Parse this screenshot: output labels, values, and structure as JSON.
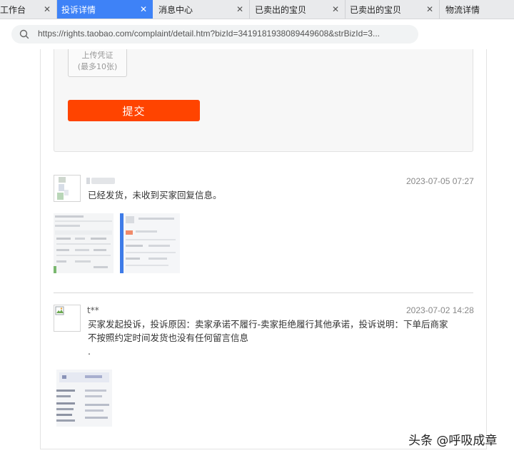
{
  "tabs": [
    {
      "label": "工作台",
      "active": false
    },
    {
      "label": "投诉详情",
      "active": true
    },
    {
      "label": "消息中心",
      "active": false
    },
    {
      "label": "已卖出的宝贝",
      "active": false
    },
    {
      "label": "已卖出的宝贝",
      "active": false
    },
    {
      "label": "物流详情",
      "active": false
    }
  ],
  "address": {
    "url": "https://rights.taobao.com/complaint/detail.htm?bizId=3419181938089449608&strBizId=3..."
  },
  "form": {
    "upload_line1": "上传凭证",
    "upload_line2": "(最多10张)",
    "submit_label": "提交"
  },
  "comments": [
    {
      "name": "",
      "time": "2023-07-05 07:27",
      "text": "已经发货，未收到买家回复信息。"
    },
    {
      "name": "t**",
      "time": "2023-07-02 14:28",
      "text_line1": "买家发起投诉，投诉原因：卖家承诺不履行-卖家拒绝履行其他承诺，投诉说明：下单后商家",
      "text_line2": "不按照约定时间发货也没有任何留言信息",
      "text_line3": "."
    }
  ],
  "watermark": "头条 @呼吸成章",
  "colors": {
    "active_tab": "#3e82f7",
    "submit": "#ff4400"
  }
}
